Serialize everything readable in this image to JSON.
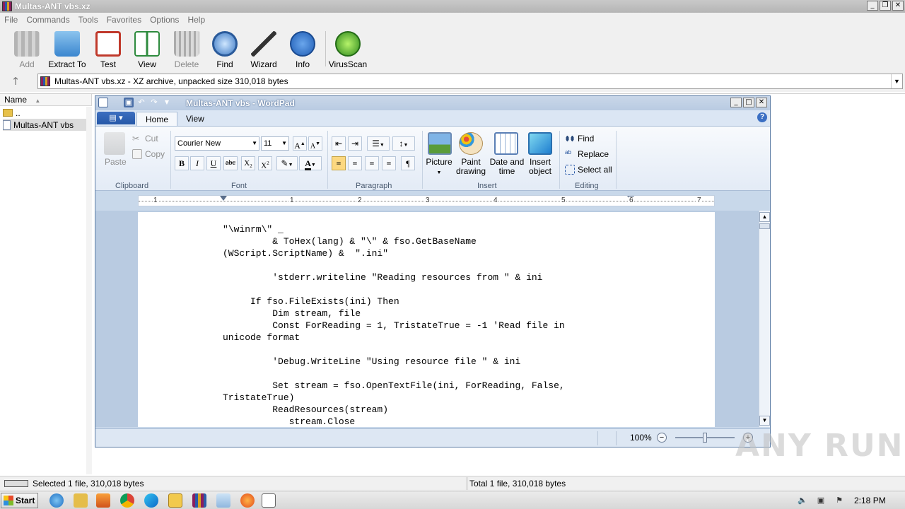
{
  "rar": {
    "title": "Multas-ANT vbs.xz",
    "menu": [
      "File",
      "Commands",
      "Tools",
      "Favorites",
      "Options",
      "Help"
    ],
    "toolbar": {
      "add": "Add",
      "extract": "Extract To",
      "test": "Test",
      "view": "View",
      "delete": "Delete",
      "find": "Find",
      "wizard": "Wizard",
      "info": "Info",
      "virusscan": "VirusScan"
    },
    "address": "Multas-ANT vbs.xz - XZ archive, unpacked size 310,018 bytes",
    "column_name": "Name",
    "files": [
      "..",
      "Multas-ANT vbs"
    ],
    "status_left": "Selected 1 file, 310,018 bytes",
    "status_right": "Total 1 file, 310,018 bytes"
  },
  "wordpad": {
    "title": "Multas-ANT vbs - WordPad",
    "tabs": [
      "Home",
      "View"
    ],
    "clipboard": {
      "paste": "Paste",
      "cut": "Cut",
      "copy": "Copy",
      "label": "Clipboard"
    },
    "font": {
      "family": "Courier New",
      "size": "11",
      "label": "Font"
    },
    "paragraph": {
      "label": "Paragraph"
    },
    "insert": {
      "picture": "Picture",
      "paint_1": "Paint",
      "paint_2": "drawing",
      "datetime_1": "Date and",
      "datetime_2": "time",
      "object_1": "Insert",
      "object_2": "object",
      "label": "Insert"
    },
    "editing": {
      "find": "Find",
      "replace": "Replace",
      "select_all": "Select all",
      "label": "Editing"
    },
    "ruler": [
      "1",
      "1",
      "2",
      "3",
      "4",
      "5",
      "6",
      "7"
    ],
    "document_lines": [
      "\"\\winrm\\\" _",
      "         & ToHex(lang) & \"\\\" & fso.GetBaseName",
      "(WScript.ScriptName) &  \".ini\"",
      "",
      "         'stderr.writeline \"Reading resources from \" & ini",
      "",
      "     If fso.FileExists(ini) Then",
      "         Dim stream, file",
      "         Const ForReading = 1, TristateTrue = -1 'Read file in",
      "unicode format",
      "",
      "         'Debug.WriteLine \"Using resource file \" & ini",
      "",
      "         Set stream = fso.OpenTextFile(ini, ForReading, False,",
      "TristateTrue)",
      "         ReadResources(stream)",
      "            stream.Close"
    ],
    "zoom": "100%"
  },
  "watermark": "ANY RUN",
  "taskbar": {
    "start": "Start",
    "clock": "2:18 PM"
  },
  "colors": {
    "wp_title": "#b9cbe2",
    "ribbon": "#e3ebf6",
    "rar_bg": "#f0f0f0",
    "file_button": "#2658a8"
  }
}
